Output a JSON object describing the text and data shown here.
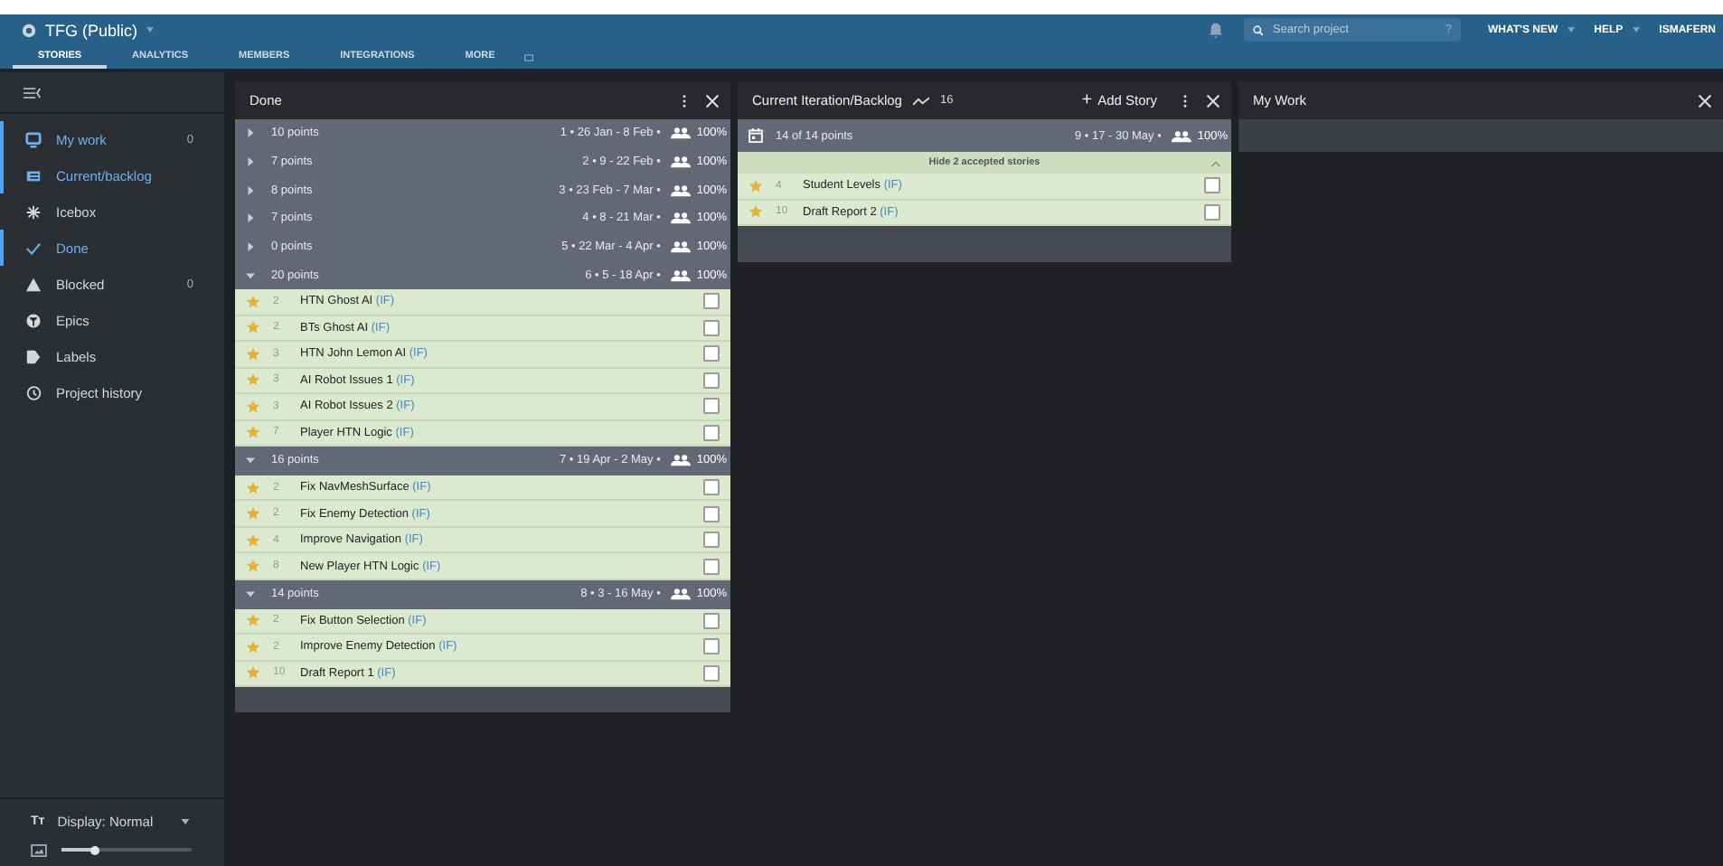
{
  "project": {
    "title": "TFG (Public)"
  },
  "nav_tabs": [
    {
      "label": "STORIES",
      "selected": true
    },
    {
      "label": "ANALYTICS",
      "selected": false
    },
    {
      "label": "MEMBERS",
      "selected": false
    },
    {
      "label": "INTEGRATIONS",
      "selected": false
    },
    {
      "label": "MORE",
      "selected": false
    }
  ],
  "search": {
    "placeholder": "Search project",
    "help": "?"
  },
  "top_links": [
    "WHAT'S NEW",
    "HELP",
    "ISMAFERN"
  ],
  "sidebar": {
    "items": [
      {
        "label": "My work",
        "count": "0",
        "selected": true,
        "kind": "mywork"
      },
      {
        "label": "Current/backlog",
        "selected": true,
        "kind": "current"
      },
      {
        "label": "Icebox",
        "selected": false,
        "kind": "icebox"
      },
      {
        "label": "Done",
        "selected": true,
        "kind": "done"
      },
      {
        "label": "Blocked",
        "count": "0",
        "selected": false,
        "kind": "blocked"
      },
      {
        "label": "Epics",
        "selected": false,
        "kind": "epics"
      },
      {
        "label": "Labels",
        "selected": false,
        "kind": "labels"
      },
      {
        "label": "Project history",
        "selected": false,
        "kind": "history"
      }
    ],
    "display_icon": "Tт",
    "display": "Display: Normal",
    "zoom": {
      "level": 0.25
    }
  },
  "done_panel": {
    "title": "Done",
    "iterations": [
      {
        "points": "10 points",
        "dates": "1 • 26 Jan - 8 Feb •",
        "percent": "100%",
        "expanded": false
      },
      {
        "points": "7 points",
        "dates": "2 • 9 - 22 Feb •",
        "percent": "100%",
        "expanded": false
      },
      {
        "points": "8 points",
        "dates": "3 • 23 Feb - 7 Mar •",
        "percent": "100%",
        "expanded": false
      },
      {
        "points": "7 points",
        "dates": "4 • 8 - 21 Mar •",
        "percent": "100%",
        "expanded": false
      },
      {
        "points": "0 points",
        "dates": "5 • 22 Mar - 4 Apr •",
        "percent": "100%",
        "expanded": false
      },
      {
        "points": "20 points",
        "dates": "6 • 5 - 18 Apr •",
        "percent": "100%",
        "expanded": true,
        "stories": [
          {
            "estimate": "2",
            "title": "HTN Ghost AI",
            "label": "(IF)",
            "checked": false
          },
          {
            "estimate": "2",
            "title": "BTs Ghost AI",
            "label": "(IF)",
            "checked": false
          },
          {
            "estimate": "3",
            "title": "HTN John Lemon AI",
            "label": "(IF)",
            "checked": false
          },
          {
            "estimate": "3",
            "title": "AI Robot Issues 1",
            "label": "(IF)",
            "checked": false
          },
          {
            "estimate": "3",
            "title": "AI Robot Issues 2",
            "label": "(IF)",
            "checked": false
          },
          {
            "estimate": "7",
            "title": "Player HTN Logic",
            "label": "(IF)",
            "checked": false
          }
        ]
      },
      {
        "points": "16 points",
        "dates": "7 • 19 Apr - 2 May •",
        "percent": "100%",
        "expanded": true,
        "stories": [
          {
            "estimate": "2",
            "title": "Fix NavMeshSurface",
            "label": "(IF)",
            "checked": false
          },
          {
            "estimate": "2",
            "title": "Fix Enemy Detection",
            "label": "(IF)",
            "checked": false
          },
          {
            "estimate": "4",
            "title": "Improve Navigation",
            "label": "(IF)",
            "checked": false
          },
          {
            "estimate": "8",
            "title": "New Player HTN Logic",
            "label": "(IF)",
            "checked": false
          }
        ]
      },
      {
        "points": "14 points",
        "dates": "8 • 3 - 16 May •",
        "percent": "100%",
        "expanded": true,
        "stories": [
          {
            "estimate": "2",
            "title": "Fix Button Selection",
            "label": "(IF)",
            "checked": false
          },
          {
            "estimate": "2",
            "title": "Improve Enemy Detection",
            "label": "(IF)",
            "checked": false
          },
          {
            "estimate": "10",
            "title": "Draft Report 1",
            "label": "(IF)",
            "checked": false
          }
        ]
      }
    ]
  },
  "current_panel": {
    "title": "Current Iteration/Backlog",
    "velocity": "16",
    "add_icon": "+",
    "add_label": "Add Story",
    "iteration": {
      "points": "14 of 14 points",
      "dates": "9 • 17 - 30 May •",
      "percent": "100%"
    },
    "hide_accepted": "Hide 2 accepted stories",
    "stories": [
      {
        "estimate": "4",
        "title": "Student Levels",
        "label": "(IF)",
        "checked": false
      },
      {
        "estimate": "10",
        "title": "Draft Report 2",
        "label": "(IF)",
        "checked": false
      }
    ]
  },
  "mywork_panel": {
    "title": "My Work"
  }
}
